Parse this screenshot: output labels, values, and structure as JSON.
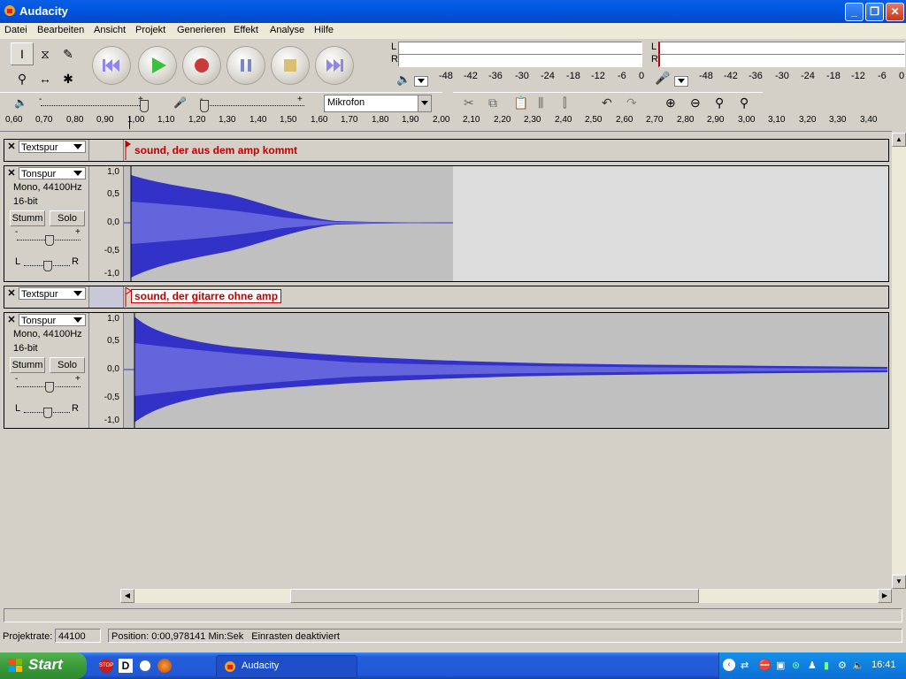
{
  "window": {
    "title": "Audacity"
  },
  "menu": [
    "Datei",
    "Bearbeiten",
    "Ansicht",
    "Projekt",
    "Generieren",
    "Effekt",
    "Analyse",
    "Hilfe"
  ],
  "meters": {
    "playback_scale": [
      "-48",
      "-42",
      "-36",
      "-30",
      "-24",
      "-18",
      "-12",
      "-6",
      "0"
    ],
    "record_scale": [
      "-48",
      "-42",
      "-36",
      "-30",
      "-24",
      "-18",
      "-12",
      "-6",
      "0"
    ],
    "left": "L",
    "right": "R"
  },
  "mixer": {
    "input_source": "Mikrofon",
    "minus": "-",
    "plus": "+"
  },
  "ruler_ticks": [
    "0,60",
    "0,70",
    "0,80",
    "0,90",
    "1,00",
    "1,10",
    "1,20",
    "1,30",
    "1,40",
    "1,50",
    "1,60",
    "1,70",
    "1,80",
    "1,90",
    "2,00",
    "2,10",
    "2,20",
    "2,30",
    "2,40",
    "2,50",
    "2,60",
    "2,70",
    "2,80",
    "2,90",
    "3,00",
    "3,10",
    "3,20",
    "3,30",
    "3,40"
  ],
  "tracks": [
    {
      "type": "label",
      "name": "Textspur",
      "label_text": "sound, der aus dem amp kommt"
    },
    {
      "type": "audio",
      "name": "Tonspur",
      "info1": "Mono, 44100Hz",
      "info2": "16-bit",
      "mute": "Stumm",
      "solo": "Solo",
      "pan_l": "L",
      "pan_r": "R",
      "gain_minus": "-",
      "gain_plus": "+",
      "scale": [
        "1,0",
        "0,5",
        "0,0",
        "-0,5",
        "-1,0"
      ]
    },
    {
      "type": "label",
      "name": "Textspur",
      "label_text": "sound, der gitarre ohne amp"
    },
    {
      "type": "audio",
      "name": "Tonspur",
      "info1": "Mono, 44100Hz",
      "info2": "16-bit",
      "mute": "Stumm",
      "solo": "Solo",
      "pan_l": "L",
      "pan_r": "R",
      "gain_minus": "-",
      "gain_plus": "+",
      "scale": [
        "1,0",
        "0,5",
        "0,0",
        "-0,5",
        "-1,0"
      ]
    }
  ],
  "status": {
    "rate_label": "Projektrate:",
    "rate_value": "44100",
    "position": "Position: 0:00,978141 Min:Sek",
    "snap": "Einrasten deaktiviert"
  },
  "taskbar": {
    "start": "Start",
    "app": "Audacity",
    "clock": "16:41"
  },
  "colors": {
    "wave": "#3232c8",
    "wave_light": "#6464dc",
    "selection": "#c0c0c0",
    "label_red": "#c00000"
  }
}
